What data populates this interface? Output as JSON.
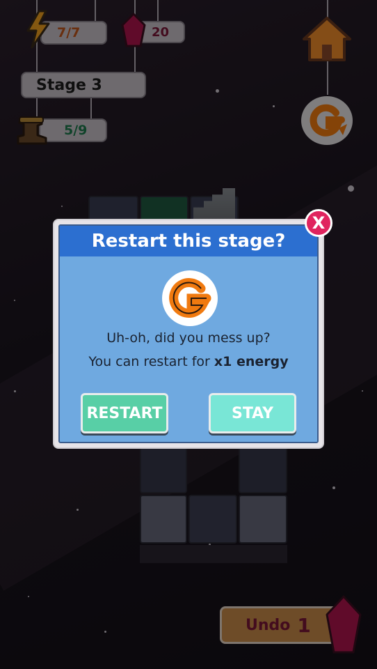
{
  "hud": {
    "energy": "7/7",
    "gems": "20",
    "stage_label": "Stage 3",
    "moves": "5/9",
    "icons": {
      "energy": "lightning-icon",
      "gem": "gem-icon",
      "boot": "boot-icon",
      "home": "home-icon",
      "restart": "restart-icon"
    }
  },
  "dialog": {
    "title": "Restart this stage?",
    "line1": "Uh-oh, did you mess up?",
    "line2_prefix": "You can restart for ",
    "line2_bold": "x1 energy",
    "restart_label": "RESTART",
    "stay_label": "STAY",
    "close_label": "X"
  },
  "undo": {
    "label": "Undo",
    "count": "1"
  },
  "colors": {
    "header_blue": "#2c6fd0",
    "body_blue": "#6fa9e0",
    "restart_green": "#58cfa6",
    "stay_cyan": "#79e6d6",
    "close_pink": "#e0245e",
    "energy_text": "#c0561c",
    "gem_text": "#7a1638",
    "moves_text": "#1e7a4e"
  }
}
